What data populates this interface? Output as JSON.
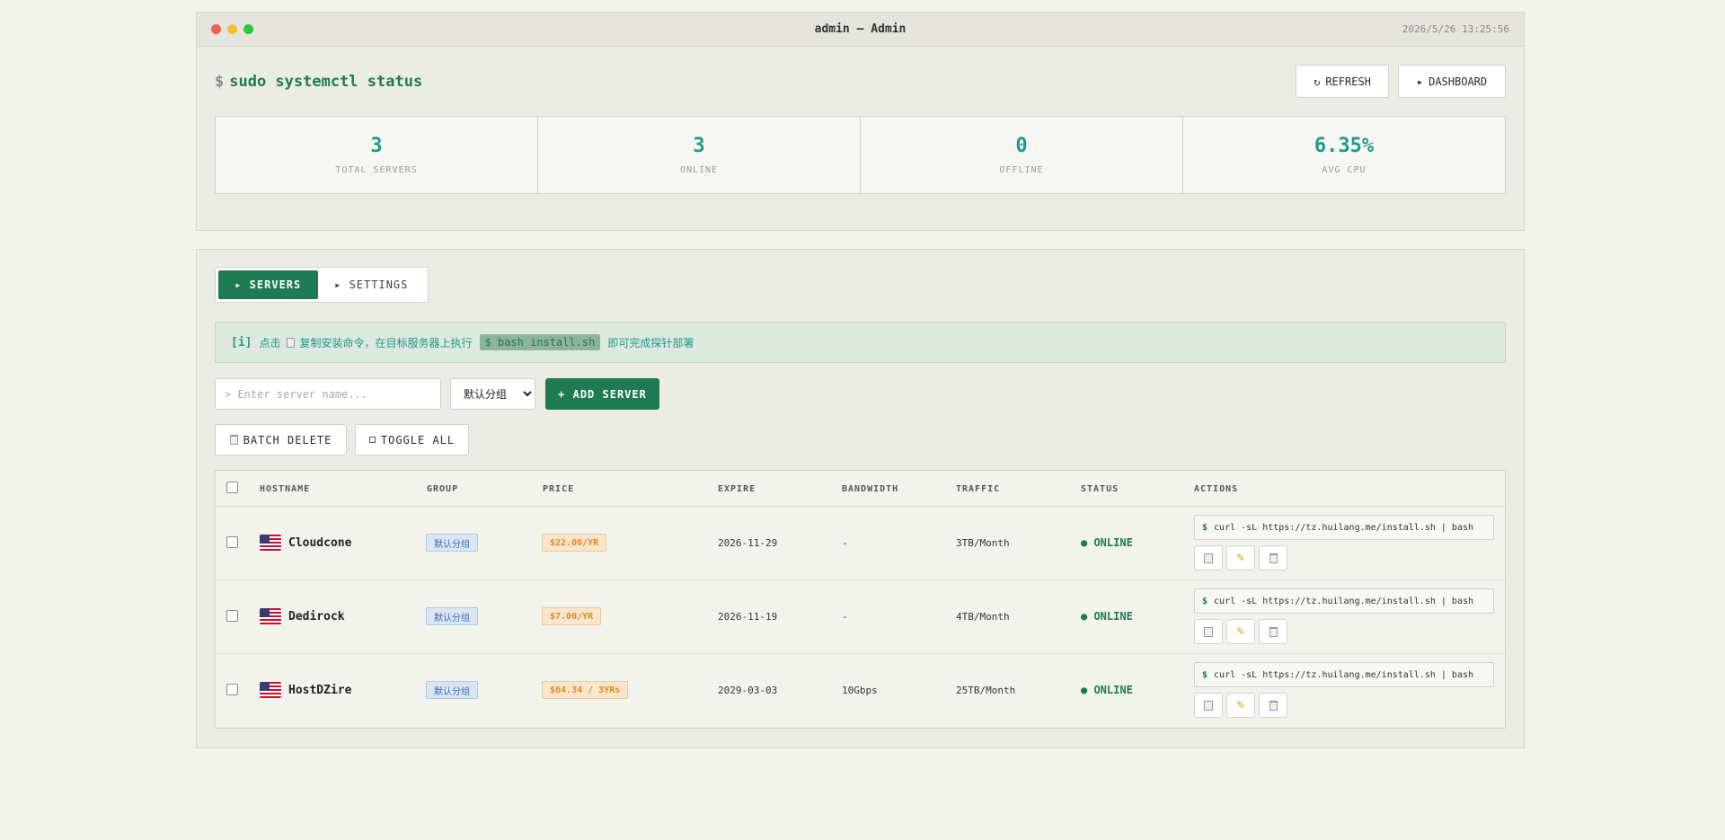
{
  "window": {
    "title": "admin — Admin",
    "timestamp": "2026/5/26 13:25:56"
  },
  "header": {
    "prompt": "$",
    "command": "sudo systemctl status",
    "refresh_label": "REFRESH",
    "refresh_icon": "↻",
    "dashboard_label": "DASHBOARD",
    "dashboard_icon": "▸"
  },
  "stats": [
    {
      "value": "3",
      "label": "TOTAL SERVERS"
    },
    {
      "value": "3",
      "label": "ONLINE"
    },
    {
      "value": "0",
      "label": "OFFLINE"
    },
    {
      "value": "6.35%",
      "label": "AVG CPU"
    }
  ],
  "tabs": {
    "servers": "▸ SERVERS",
    "settings": "▸ SETTINGS"
  },
  "info": {
    "tag": "[i]",
    "text_before": "点击",
    "text_mid": "复制安装命令，在目标服务器上执行",
    "code": "$ bash install.sh",
    "text_after": "即可完成探针部署"
  },
  "toolbar": {
    "search_placeholder": "> Enter server name...",
    "group_selected": "默认分组",
    "add_label": "+ ADD SERVER",
    "batch_delete_label": "BATCH DELETE",
    "toggle_all_label": "TOGGLE ALL"
  },
  "table": {
    "headers": [
      "HOSTNAME",
      "GROUP",
      "PRICE",
      "EXPIRE",
      "BANDWIDTH",
      "TRAFFIC",
      "STATUS",
      "ACTIONS"
    ],
    "rows": [
      {
        "hostname": "Cloudcone",
        "group": "默认分组",
        "price": "$22.00/YR",
        "expire": "2026-11-29",
        "bandwidth": "-",
        "traffic": "3TB/Month",
        "status": "● ONLINE",
        "command": "curl -sL https://tz.huilang.me/install.sh | bash"
      },
      {
        "hostname": "Dedirock",
        "group": "默认分组",
        "price": "$7.00/YR",
        "expire": "2026-11-19",
        "bandwidth": "-",
        "traffic": "4TB/Month",
        "status": "● ONLINE",
        "command": "curl -sL https://tz.huilang.me/install.sh | bash"
      },
      {
        "hostname": "HostDZire",
        "group": "默认分组",
        "price": "$64.34 / 3YRs",
        "expire": "2029-03-03",
        "bandwidth": "10Gbps",
        "traffic": "25TB/Month",
        "status": "● ONLINE",
        "command": "curl -sL https://tz.huilang.me/install.sh | bash"
      }
    ],
    "command_prompt": "$"
  },
  "colors": {
    "accent": "#1e7a52",
    "stat_value": "#1e9a88",
    "price": "#e08a22",
    "group_badge": "#3f6bb0"
  },
  "icons": {
    "flag": "us-flag-icon",
    "copy": "clipboard-icon",
    "edit": "pencil-icon",
    "delete": "trash-icon",
    "edit_glyph": "✎"
  }
}
